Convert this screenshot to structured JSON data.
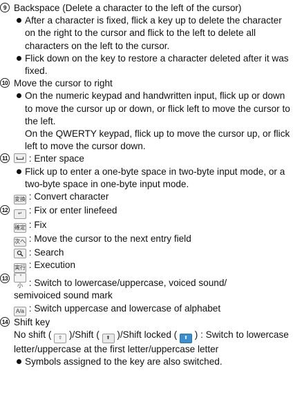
{
  "items": {
    "i9": {
      "num": "9",
      "title": "Backspace (Delete a character to the left of the cursor)",
      "b1": "After a character is fixed, flick a key up to delete the character on the right to the cursor and flick to the left to delete all characters on the left to the cursor.",
      "b2": "Flick down on the key to restore a character deleted after it was fixed."
    },
    "i10": {
      "num": "10",
      "title": "Move the cursor to right",
      "b1": "On the numeric keypad and handwritten input, flick up or down to move the cursor up or down, or flick left to move the cursor to the left.",
      "p1": "On the QWERTY keypad, flick up to move the cursor up, or flick left to move the cursor down."
    },
    "i11": {
      "num": "11",
      "title": ": Enter space",
      "b1": "Flick up to enter a one-byte space in two-byte input mode, or a two-byte space in one-byte input mode.",
      "convert": ": Convert character"
    },
    "i12": {
      "num": "12",
      "l1": ": Fix or enter linefeed",
      "l2": ": Fix",
      "l3": ": Move the cursor to the next entry field",
      "l4": ": Search",
      "l5": ": Execution"
    },
    "i13": {
      "num": "13",
      "l1": ": Switch to lowercase/uppercase, voiced sound/",
      "l1b": "semivoiced sound mark",
      "l2": ": Switch uppercase and lowercase of alphabet",
      "aa_key": "A/a"
    },
    "i14": {
      "num": "14",
      "title": "Shift key",
      "p1a": "No shift (",
      "p1b": ")/Shift (",
      "p1c": ")/Shift locked (",
      "p1d": ") : Switch to lowercase letter/uppercase at the first letter/uppercase letter",
      "b1": "Symbols assigned to the key are also switched."
    }
  },
  "key_glyphs": {
    "convert": "変換",
    "enter": "↵",
    "fix": "確定",
    "next": "次へ",
    "search": "🔍",
    "execute": "実行",
    "kana": "゛゜小",
    "shift_none": "⇧",
    "shift_on": "⬆",
    "shift_lock": "⬆"
  },
  "colors": {
    "shift_lock_bg": "#3a8fd0"
  }
}
